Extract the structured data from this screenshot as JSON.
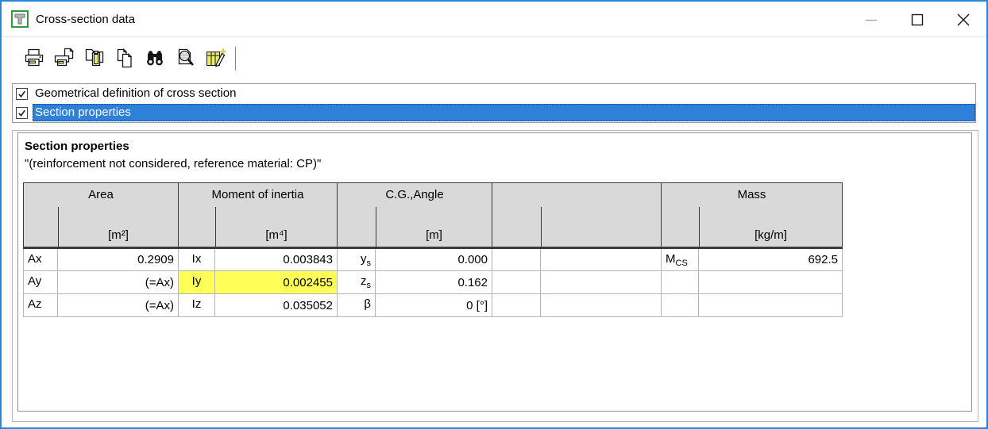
{
  "window": {
    "title": "Cross-section data",
    "app_icon": "green-T-app-icon",
    "controls": [
      {
        "name": "minimize"
      },
      {
        "name": "maximize"
      },
      {
        "name": "close"
      }
    ]
  },
  "colors": {
    "accent": "#2787d8",
    "selection": "#2f80d9",
    "highlight": "#ffff57",
    "header_bg": "#d9d9d9",
    "grid_light": "#b4b4b4",
    "grid_dark": "#3a3a3a"
  },
  "toolbar": {
    "buttons": [
      {
        "name": "print"
      },
      {
        "name": "print-preview"
      },
      {
        "name": "paste"
      },
      {
        "name": "copy"
      },
      {
        "name": "find"
      },
      {
        "name": "zoom-preview"
      },
      {
        "name": "edit-table"
      }
    ]
  },
  "checkbox_list": {
    "items": [
      {
        "label": "Geometrical definition of cross section",
        "checked": true,
        "selected": false
      },
      {
        "label": "Section properties",
        "checked": true,
        "selected": true
      }
    ]
  },
  "section": {
    "title": "Section properties",
    "subtitle": "\"(reinforcement not considered, reference material: CP)\""
  },
  "table": {
    "groups": [
      {
        "title": "Area",
        "unit": "[m²]"
      },
      {
        "title": "Moment of inertia",
        "unit": "[m⁴]"
      },
      {
        "title": "C.G.,Angle",
        "unit": "[m]"
      },
      {
        "title": "",
        "unit": ""
      },
      {
        "title": "Mass",
        "unit": "[kg/m]"
      }
    ],
    "rows": [
      [
        {
          "l": "Ax",
          "ls": "",
          "v": "0.2909"
        },
        {
          "l": "Ix",
          "ls": "",
          "v": "0.003843"
        },
        {
          "l": "y",
          "ls": "s",
          "v": "0.000"
        },
        {
          "l": "",
          "ls": "",
          "v": ""
        },
        {
          "l": "M",
          "ls": "CS",
          "v": "692.5"
        }
      ],
      [
        {
          "l": "Ay",
          "ls": "",
          "v": "(=Ax)"
        },
        {
          "l": "Iy",
          "ls": "",
          "v": "0.002455"
        },
        {
          "l": "z",
          "ls": "s",
          "v": "0.162"
        },
        {
          "l": "",
          "ls": "",
          "v": ""
        },
        {
          "l": "",
          "ls": "",
          "v": ""
        }
      ],
      [
        {
          "l": "Az",
          "ls": "",
          "v": "(=Ax)"
        },
        {
          "l": "Iz",
          "ls": "",
          "v": "0.035052"
        },
        {
          "l": "β",
          "ls": "",
          "v": "0 [°]"
        },
        {
          "l": "",
          "ls": "",
          "v": ""
        },
        {
          "l": "",
          "ls": "",
          "v": ""
        }
      ]
    ]
  }
}
